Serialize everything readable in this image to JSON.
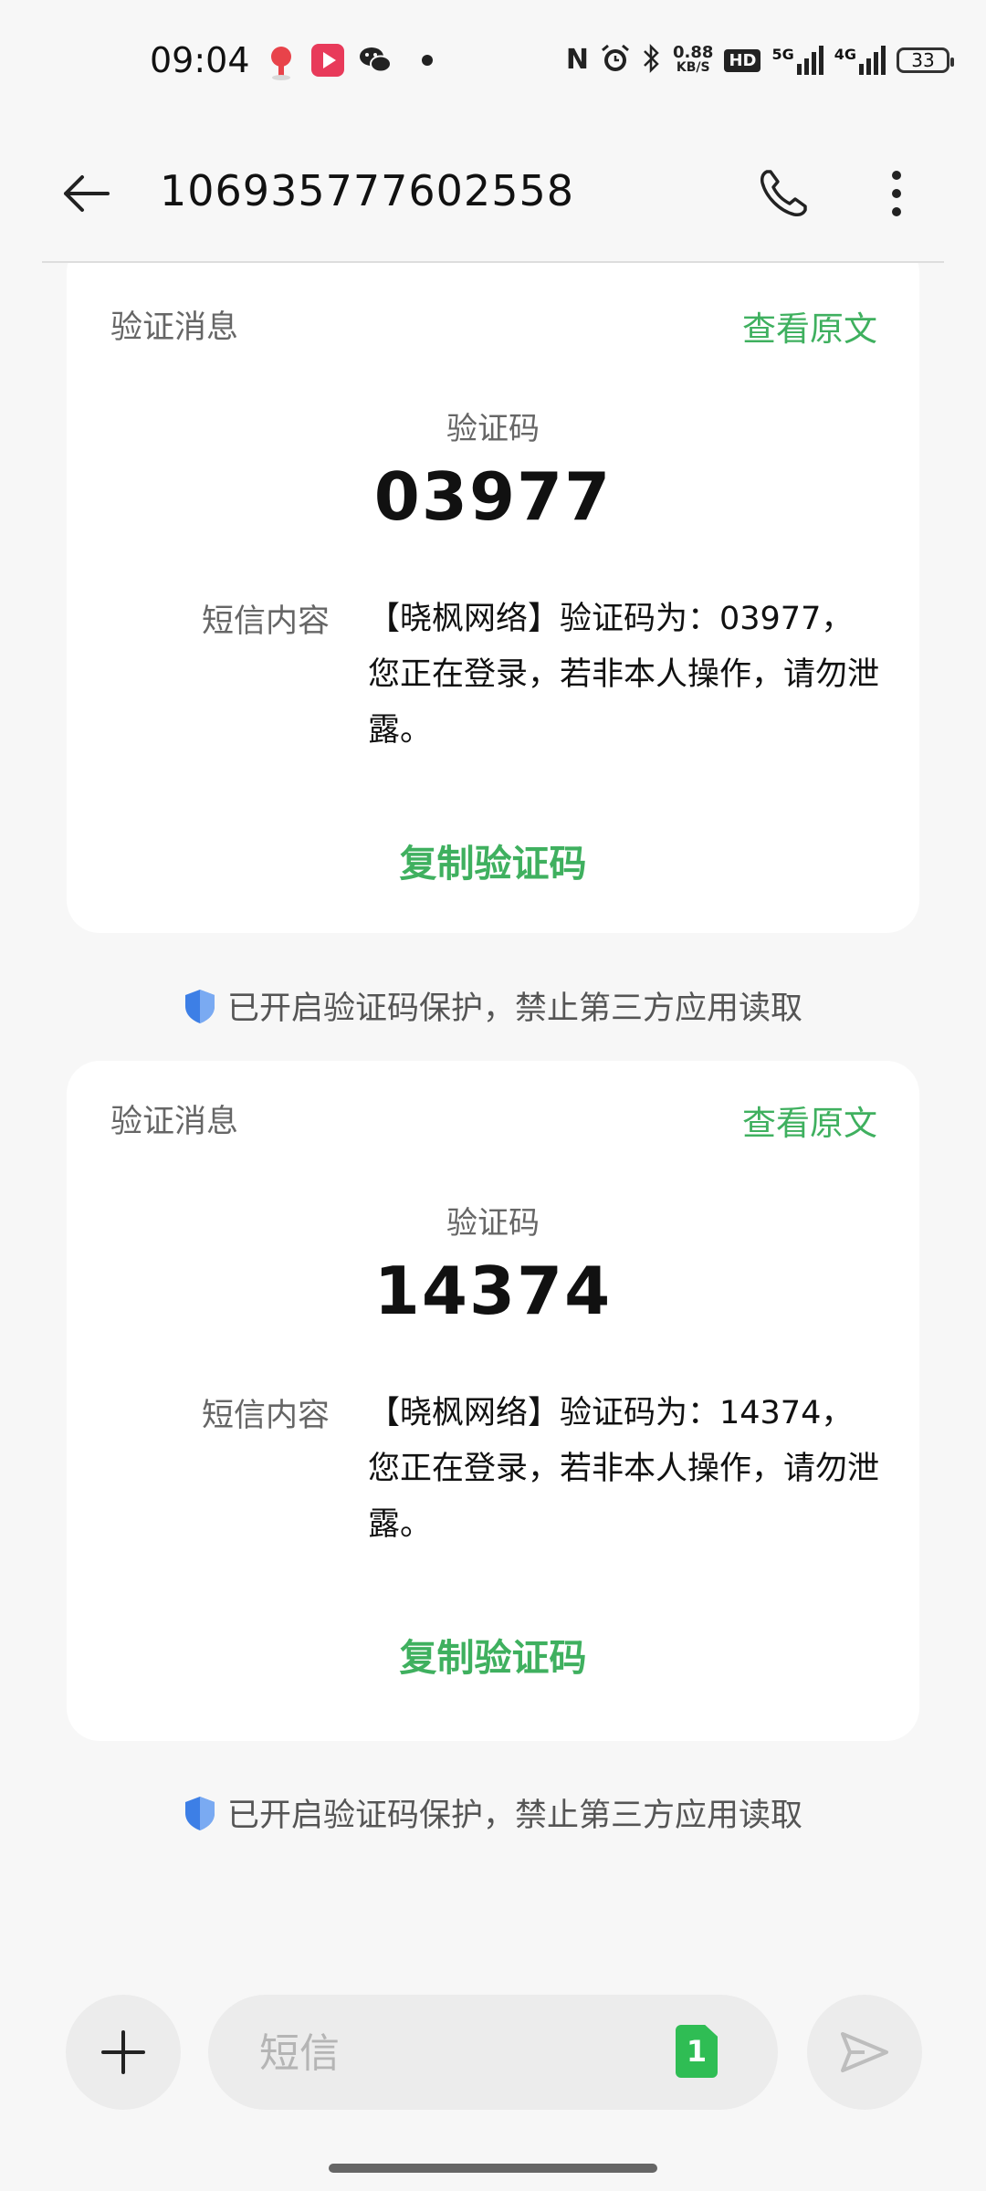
{
  "status_bar": {
    "time": "09:04",
    "net_speed_value": "0.88",
    "net_speed_unit": "KB/S",
    "hd_badge": "HD",
    "network_1": "5G",
    "network_2": "4G",
    "battery": "33",
    "icons": [
      "location-app-icon",
      "video-app-icon",
      "wechat-icon",
      "dot-icon",
      "nfc-icon",
      "alarm-icon",
      "bluetooth-icon",
      "signal-icon",
      "battery-icon"
    ]
  },
  "header": {
    "title": "106935777602558",
    "icons": [
      "back-arrow-icon",
      "phone-icon",
      "more-vertical-icon"
    ]
  },
  "messages": [
    {
      "label": "验证消息",
      "view_original": "查看原文",
      "code_label": "验证码",
      "code": "03977",
      "content_label": "短信内容",
      "content": "【晓枫网络】验证码为：03977，您正在登录，若非本人操作，请勿泄露。",
      "copy_button": "复制验证码"
    },
    {
      "label": "验证消息",
      "view_original": "查看原文",
      "code_label": "验证码",
      "code": "14374",
      "content_label": "短信内容",
      "content": "【晓枫网络】验证码为：14374，您正在登录，若非本人操作，请勿泄露。",
      "copy_button": "复制验证码"
    }
  ],
  "protection_notice": "已开启验证码保护，禁止第三方应用读取",
  "composer": {
    "placeholder": "短信",
    "sim_number": "1",
    "icons": [
      "plus-icon",
      "sim-card-icon",
      "send-icon"
    ]
  },
  "colors": {
    "accent_green": "#3fb05f",
    "sim_green": "#2fbd54",
    "background": "#f7f7f7",
    "shield_blue": "#3d7fe6"
  }
}
